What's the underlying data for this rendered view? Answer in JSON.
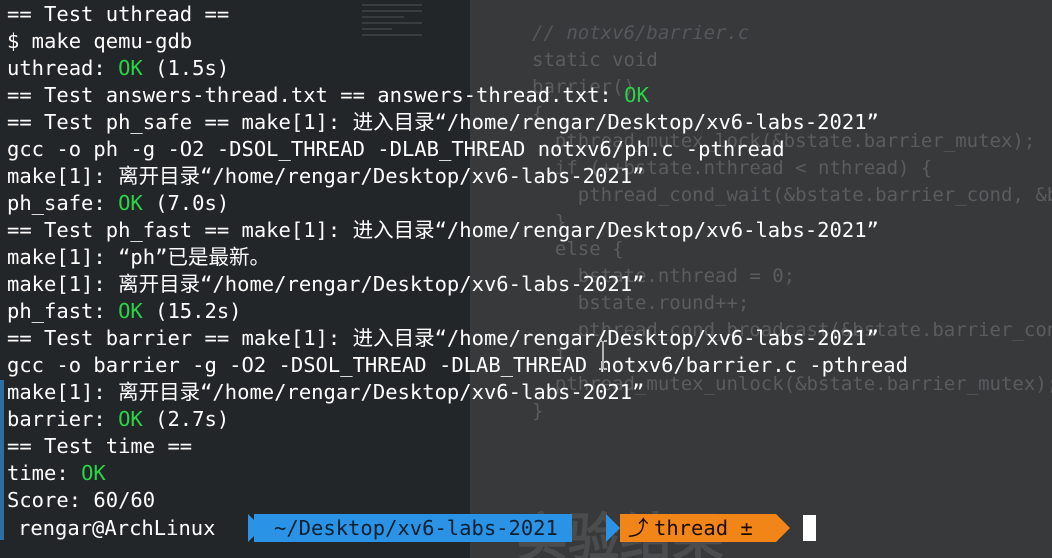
{
  "terminal": {
    "lines": [
      {
        "pre": "== Test uthread ==",
        "ok": "",
        "post": ""
      },
      {
        "pre": "$ make qemu-gdb",
        "ok": "",
        "post": ""
      },
      {
        "pre": "uthread: ",
        "ok": "OK",
        "post": " (1.5s)"
      },
      {
        "pre": "== Test answers-thread.txt == answers-thread.txt: ",
        "ok": "OK",
        "post": ""
      },
      {
        "pre": "== Test ph_safe == make[1]: 进入目录“/home/rengar/Desktop/xv6-labs-2021”",
        "ok": "",
        "post": ""
      },
      {
        "pre": "gcc -o ph -g -O2 -DSOL_THREAD -DLAB_THREAD notxv6/ph.c -pthread",
        "ok": "",
        "post": ""
      },
      {
        "pre": "make[1]: 离开目录“/home/rengar/Desktop/xv6-labs-2021”",
        "ok": "",
        "post": ""
      },
      {
        "pre": "ph_safe: ",
        "ok": "OK",
        "post": " (7.0s)"
      },
      {
        "pre": "== Test ph_fast == make[1]: 进入目录“/home/rengar/Desktop/xv6-labs-2021”",
        "ok": "",
        "post": ""
      },
      {
        "pre": "make[1]: “ph”已是最新。",
        "ok": "",
        "post": ""
      },
      {
        "pre": "make[1]: 离开目录“/home/rengar/Desktop/xv6-labs-2021”",
        "ok": "",
        "post": ""
      },
      {
        "pre": "ph_fast: ",
        "ok": "OK",
        "post": " (15.2s)"
      },
      {
        "pre": "== Test barrier == make[1]: 进入目录“/home/rengar/Desktop/xv6-labs-2021”",
        "ok": "",
        "post": ""
      },
      {
        "pre": "gcc -o barrier -g -O2 -DSOL_THREAD -DLAB_THREAD notxv6/barrier.c -pthread",
        "ok": "",
        "post": ""
      },
      {
        "pre": "make[1]: 离开目录“/home/rengar/Desktop/xv6-labs-2021”",
        "ok": "",
        "post": ""
      },
      {
        "pre": "barrier: ",
        "ok": "OK",
        "post": " (2.7s)"
      },
      {
        "pre": "== Test time ==",
        "ok": "",
        "post": ""
      },
      {
        "pre": "time: ",
        "ok": "OK",
        "post": ""
      },
      {
        "pre": "Score: 60/60",
        "ok": "",
        "post": ""
      }
    ]
  },
  "prompt": {
    "user_host": "rengar@ArchLinux",
    "path": "~/Desktop/xv6-labs-2021",
    "git_branch": "thread",
    "git_status": "±",
    "git_icon": "git-branch-icon"
  },
  "background": {
    "code_lines": [
      "// notxv6/barrier.c",
      "static void",
      "barrier()",
      "{",
      "  pthread_mutex_lock(&bstate.barrier_mutex);",
      "  if (++bstate.nthread < nthread) {",
      "    pthread_cond_wait(&bstate.barrier_cond, &bstate.barrier_mutex);",
      "  }",
      "  else {",
      "    bstate.nthread = 0;",
      "    bstate.round++;",
      "    pthread_cond_broadcast(&bstate.barrier_cond);",
      "  }",
      "  pthread_mutex_unlock(&bstate.barrier_mutex);",
      "}"
    ],
    "heading": "实验结果"
  },
  "colors": {
    "ok_green": "#2bd447",
    "path_blue": "#2a93e6",
    "git_orange": "#f28518"
  }
}
